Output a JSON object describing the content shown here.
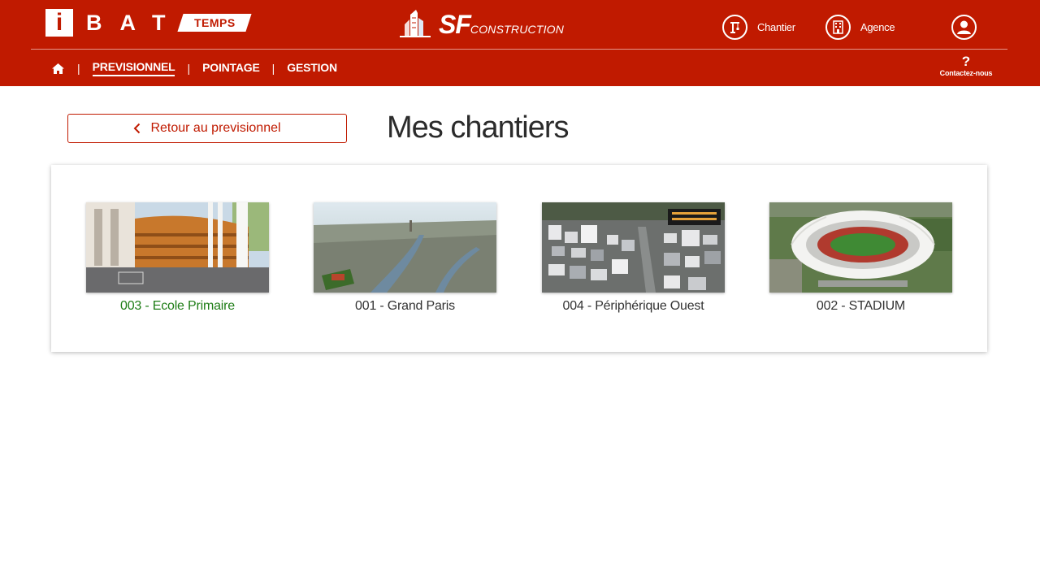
{
  "header": {
    "logo": {
      "letter": "i",
      "letters": "BAT",
      "tag": "TEMPS"
    },
    "brand": {
      "name": "SF",
      "sub": "CONSTRUCTION"
    },
    "actions": [
      {
        "label": "Chantier",
        "icon": "crane-icon"
      },
      {
        "label": "Agence",
        "icon": "building-icon"
      }
    ],
    "profile_icon": "user-icon",
    "nav": {
      "home_icon": "home-icon",
      "separator": "|",
      "items": [
        {
          "label": "PREVISIONNEL",
          "active": true
        },
        {
          "label": "POINTAGE",
          "active": false
        },
        {
          "label": "GESTION",
          "active": false
        }
      ]
    },
    "help": {
      "symbol": "?",
      "label": "Contactez-nous"
    }
  },
  "main": {
    "back_button": "Retour au previsionnel",
    "title": "Mes chantiers",
    "sites": [
      {
        "label": "003 - Ecole Primaire",
        "selected": true
      },
      {
        "label": "001 - Grand Paris",
        "selected": false
      },
      {
        "label": "004 - Périphérique Ouest",
        "selected": false
      },
      {
        "label": "002 - STADIUM",
        "selected": false
      }
    ]
  },
  "colors": {
    "primary": "#c01a00",
    "selected_text": "#1e7d16"
  }
}
